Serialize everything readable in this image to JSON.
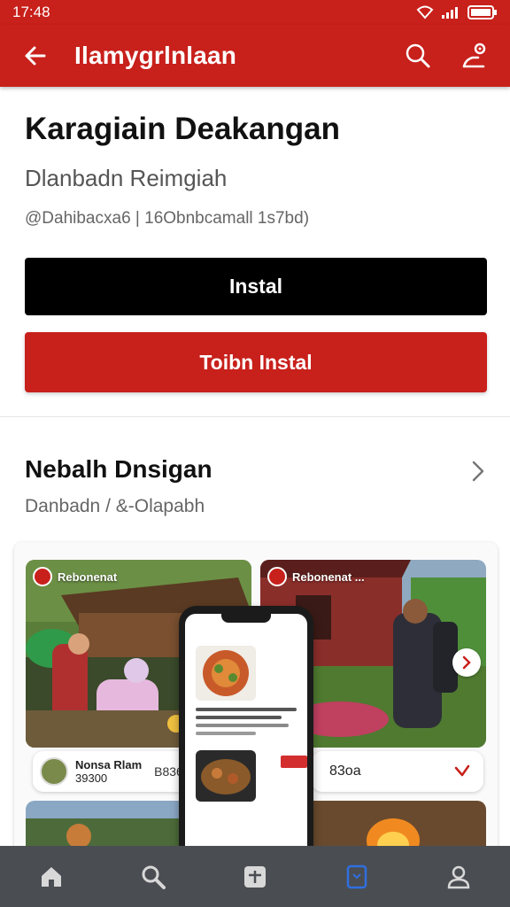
{
  "status_bar": {
    "time": "17:48",
    "icons": [
      "wifi-icon",
      "signal-icon",
      "battery-icon"
    ]
  },
  "app_bar": {
    "title": "Ilamygrlnlaan",
    "back_icon": "arrow-left-icon",
    "actions": [
      "search-icon",
      "share-pin-icon"
    ]
  },
  "app": {
    "name": "Karagiain Deakangan",
    "developer": "Dlanbadn Reimgiah",
    "meta": "@Dahibacxa6 | 16Obnbcamall 1s7bd)"
  },
  "buttons": {
    "install_label": "Instal",
    "trial_label": "Toibn Instal"
  },
  "section": {
    "title": "Nebalh Dnsigan",
    "subtitle": "Danbadn / &-Olapabh",
    "chevron_icon": "chevron-right-icon"
  },
  "gallery": {
    "cards": [
      {
        "label": "Rebonenat"
      },
      {
        "label": "Rebonenat ... "
      }
    ],
    "strip_left": {
      "name": "Nonsa Rlam",
      "sub": "39300",
      "price": "B836"
    },
    "strip_right": {
      "label": "83oa"
    }
  },
  "bottom_nav": {
    "items": [
      {
        "icon": "home-icon"
      },
      {
        "icon": "search-icon"
      },
      {
        "icon": "plus-square-icon"
      },
      {
        "icon": "bookmark-icon",
        "active": true
      },
      {
        "icon": "profile-icon"
      }
    ]
  },
  "colors": {
    "brand_red": "#c8201b",
    "install_black": "#000000",
    "nav_bg": "#4a4d52",
    "nav_active": "#2f6fe0"
  }
}
